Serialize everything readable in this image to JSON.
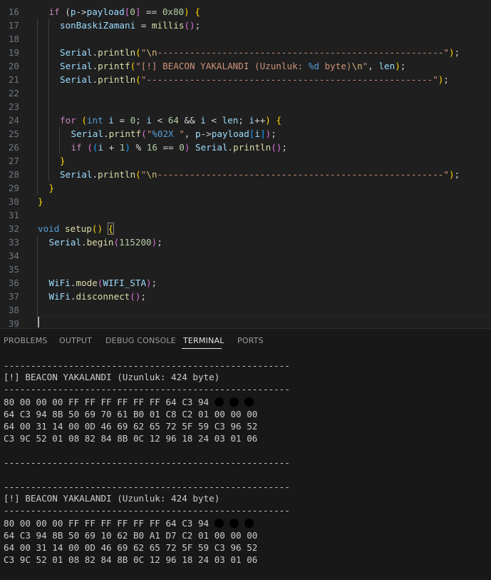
{
  "editor": {
    "lines": [
      {
        "n": "16",
        "segs": [
          [
            "k",
            "if"
          ],
          [
            "w",
            " ("
          ],
          [
            "v",
            "p"
          ],
          [
            "w",
            "->"
          ],
          [
            "v",
            "payload"
          ],
          [
            "p2",
            "["
          ],
          [
            "n",
            "0"
          ],
          [
            "p2",
            "]"
          ],
          [
            "w",
            " == "
          ],
          [
            "n",
            "0x80"
          ],
          [
            "p1",
            ")"
          ],
          [
            "w",
            " "
          ],
          [
            "p1",
            "{"
          ]
        ]
      },
      {
        "n": "17",
        "segs": [
          [
            "v",
            "sonBaskiZamani"
          ],
          [
            "w",
            " = "
          ],
          [
            "f",
            "millis"
          ],
          [
            "p2",
            "()"
          ],
          [
            "w",
            ";"
          ]
        ]
      },
      {
        "n": "18",
        "segs": []
      },
      {
        "n": "19",
        "segs": [
          [
            "v",
            "Serial"
          ],
          [
            "w",
            "."
          ],
          [
            "f",
            "println"
          ],
          [
            "p1",
            "("
          ],
          [
            "s",
            "\""
          ],
          [
            "e",
            "\\n"
          ],
          [
            "s",
            "-----------------------------------------------------\""
          ],
          [
            "p1",
            ")"
          ],
          [
            "w",
            ";"
          ]
        ]
      },
      {
        "n": "20",
        "segs": [
          [
            "v",
            "Serial"
          ],
          [
            "w",
            "."
          ],
          [
            "f",
            "printf"
          ],
          [
            "p1",
            "("
          ],
          [
            "s",
            "\"[!] BEACON YAKALANDI (Uzunluk: "
          ],
          [
            "t",
            "%d"
          ],
          [
            "s",
            " byte)"
          ],
          [
            "e",
            "\\n"
          ],
          [
            "s",
            "\""
          ],
          [
            "w",
            ", "
          ],
          [
            "v",
            "len"
          ],
          [
            "p1",
            ")"
          ],
          [
            "w",
            ";"
          ]
        ]
      },
      {
        "n": "21",
        "segs": [
          [
            "v",
            "Serial"
          ],
          [
            "w",
            "."
          ],
          [
            "f",
            "println"
          ],
          [
            "p1",
            "("
          ],
          [
            "s",
            "\"-----------------------------------------------------\""
          ],
          [
            "p1",
            ")"
          ],
          [
            "w",
            ";"
          ]
        ]
      },
      {
        "n": "22",
        "segs": []
      },
      {
        "n": "23",
        "segs": []
      },
      {
        "n": "24",
        "segs": [
          [
            "k",
            "for"
          ],
          [
            "w",
            " "
          ],
          [
            "p1",
            "("
          ],
          [
            "t",
            "int"
          ],
          [
            "w",
            " "
          ],
          [
            "v",
            "i"
          ],
          [
            "w",
            " = "
          ],
          [
            "n",
            "0"
          ],
          [
            "w",
            "; "
          ],
          [
            "v",
            "i"
          ],
          [
            "w",
            " < "
          ],
          [
            "n",
            "64"
          ],
          [
            "w",
            " && "
          ],
          [
            "v",
            "i"
          ],
          [
            "w",
            " < "
          ],
          [
            "v",
            "len"
          ],
          [
            "w",
            "; "
          ],
          [
            "v",
            "i"
          ],
          [
            "w",
            "++"
          ],
          [
            "p1",
            ")"
          ],
          [
            "w",
            " "
          ],
          [
            "p1",
            "{"
          ]
        ]
      },
      {
        "n": "25",
        "segs": [
          [
            "v",
            "Serial"
          ],
          [
            "w",
            "."
          ],
          [
            "f",
            "printf"
          ],
          [
            "p2",
            "("
          ],
          [
            "s",
            "\""
          ],
          [
            "t",
            "%02X"
          ],
          [
            "s",
            " \""
          ],
          [
            "w",
            ", "
          ],
          [
            "v",
            "p"
          ],
          [
            "w",
            "->"
          ],
          [
            "v",
            "payload"
          ],
          [
            "p3",
            "["
          ],
          [
            "v",
            "i"
          ],
          [
            "p3",
            "]"
          ],
          [
            "p2",
            ")"
          ],
          [
            "w",
            ";"
          ]
        ]
      },
      {
        "n": "26",
        "segs": [
          [
            "k",
            "if"
          ],
          [
            "w",
            " "
          ],
          [
            "p2",
            "("
          ],
          [
            "p3",
            "("
          ],
          [
            "v",
            "i"
          ],
          [
            "w",
            " + "
          ],
          [
            "n",
            "1"
          ],
          [
            "p3",
            ")"
          ],
          [
            "w",
            " % "
          ],
          [
            "n",
            "16"
          ],
          [
            "w",
            " == "
          ],
          [
            "n",
            "0"
          ],
          [
            "p2",
            ")"
          ],
          [
            "w",
            " "
          ],
          [
            "v",
            "Serial"
          ],
          [
            "w",
            "."
          ],
          [
            "f",
            "println"
          ],
          [
            "p2",
            "()"
          ],
          [
            "w",
            ";"
          ]
        ]
      },
      {
        "n": "27",
        "segs": [
          [
            "p1",
            "}"
          ]
        ]
      },
      {
        "n": "28",
        "segs": [
          [
            "v",
            "Serial"
          ],
          [
            "w",
            "."
          ],
          [
            "f",
            "println"
          ],
          [
            "p1",
            "("
          ],
          [
            "s",
            "\""
          ],
          [
            "e",
            "\\n"
          ],
          [
            "s",
            "-----------------------------------------------------\""
          ],
          [
            "p1",
            ")"
          ],
          [
            "w",
            ";"
          ]
        ]
      },
      {
        "n": "29",
        "segs": [
          [
            "p1",
            "}"
          ]
        ]
      },
      {
        "n": "30",
        "segs": [
          [
            "p1",
            "}"
          ]
        ]
      },
      {
        "n": "31",
        "segs": []
      },
      {
        "n": "32",
        "segs": [
          [
            "t",
            "void"
          ],
          [
            "w",
            " "
          ],
          [
            "f",
            "setup"
          ],
          [
            "p1",
            "()"
          ],
          [
            "w",
            " "
          ],
          [
            "p1b",
            "{"
          ]
        ]
      },
      {
        "n": "33",
        "segs": [
          [
            "v",
            "Serial"
          ],
          [
            "w",
            "."
          ],
          [
            "f",
            "begin"
          ],
          [
            "p2",
            "("
          ],
          [
            "n",
            "115200"
          ],
          [
            "p2",
            ")"
          ],
          [
            "w",
            ";"
          ]
        ]
      },
      {
        "n": "34",
        "segs": []
      },
      {
        "n": "35",
        "segs": []
      },
      {
        "n": "36",
        "segs": [
          [
            "v",
            "WiFi"
          ],
          [
            "w",
            "."
          ],
          [
            "f",
            "mode"
          ],
          [
            "p2",
            "("
          ],
          [
            "v",
            "WIFI_STA"
          ],
          [
            "p2",
            ")"
          ],
          [
            "w",
            ";"
          ]
        ]
      },
      {
        "n": "37",
        "segs": [
          [
            "v",
            "WiFi"
          ],
          [
            "w",
            "."
          ],
          [
            "f",
            "disconnect"
          ],
          [
            "p2",
            "()"
          ],
          [
            "w",
            ";"
          ]
        ]
      },
      {
        "n": "38",
        "segs": []
      },
      {
        "n": "39",
        "segs": []
      }
    ]
  },
  "panel": {
    "tabs": [
      "PROBLEMS",
      "OUTPUT",
      "DEBUG CONSOLE",
      "TERMINAL",
      "PORTS"
    ],
    "active_tab": "TERMINAL",
    "terminal": {
      "sep": "-----------------------------------------------------",
      "block1": {
        "title": "[!] BEACON YAKALANDI (Uzunluk: 424 byte)",
        "rows": [
          "80 00 00 00 FF FF FF FF FF FF 64 C3 94 ",
          "64 C3 94 8B 50 69 70 61 B0 01 C8 C2 01 00 00 00",
          "64 00 31 14 00 0D 46 69 62 65 72 5F 59 C3 96 52",
          "C3 9C 52 01 08 82 84 8B 0C 12 96 18 24 03 01 06"
        ]
      },
      "block2": {
        "title": "[!] BEACON YAKALANDI (Uzunluk: 424 byte)",
        "rows": [
          "80 00 00 00 FF FF FF FF FF FF 64 C3 94 ",
          "64 C3 94 8B 50 69 10 62 B0 A1 D7 C2 01 00 00 00",
          "64 00 31 14 00 0D 46 69 62 65 72 5F 59 C3 96 52",
          "C3 9C 52 01 08 82 84 8B 0C 12 96 18 24 03 01 06"
        ]
      }
    }
  }
}
